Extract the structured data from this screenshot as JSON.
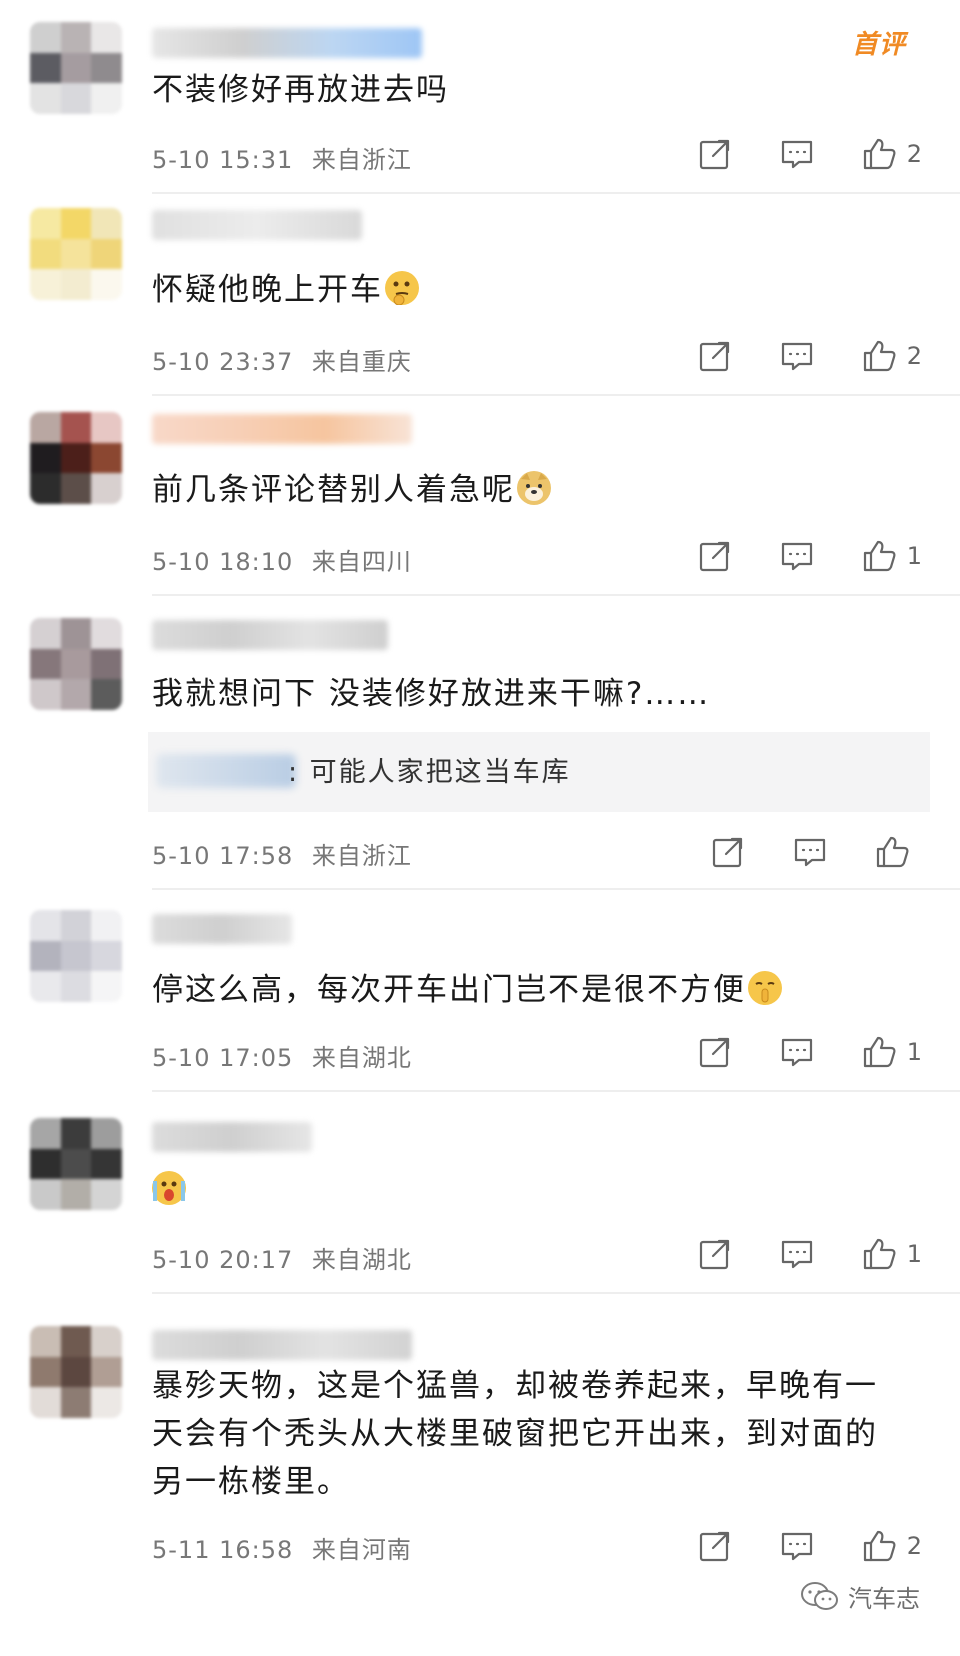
{
  "badge": "首评",
  "comments": [
    {
      "text": "不装修好再放进去吗",
      "date": "5-10 15:31",
      "location": "来自浙江",
      "likes": "2"
    },
    {
      "text": "怀疑他晚上开车",
      "date": "5-10 23:37",
      "location": "来自重庆",
      "likes": "2"
    },
    {
      "text": "前几条评论替别人着急呢",
      "date": "5-10 18:10",
      "location": "来自四川",
      "likes": "1"
    },
    {
      "text": "我就想问下 没装修好放进来干嘛?……",
      "date": "5-10 17:58",
      "location": "来自浙江",
      "likes": "",
      "reply": ": 可能人家把这当车库"
    },
    {
      "text": "停这么高，每次开车出门岂不是很不方便",
      "date": "5-10 17:05",
      "location": "来自湖北",
      "likes": "1"
    },
    {
      "text": "",
      "date": "5-10 20:17",
      "location": "来自湖北",
      "likes": "1"
    },
    {
      "text": "暴殄天物，这是个猛兽，却被卷养起来，早晚有一天会有个秃头从大楼里破窗把它开出来，到对面的另一栋楼里。",
      "date": "5-11 16:58",
      "location": "来自河南",
      "likes": "2"
    }
  ],
  "watermark": "汽车志",
  "icons": {
    "share": "share-icon",
    "comment": "comment-icon",
    "like": "thumbs-up-icon"
  }
}
